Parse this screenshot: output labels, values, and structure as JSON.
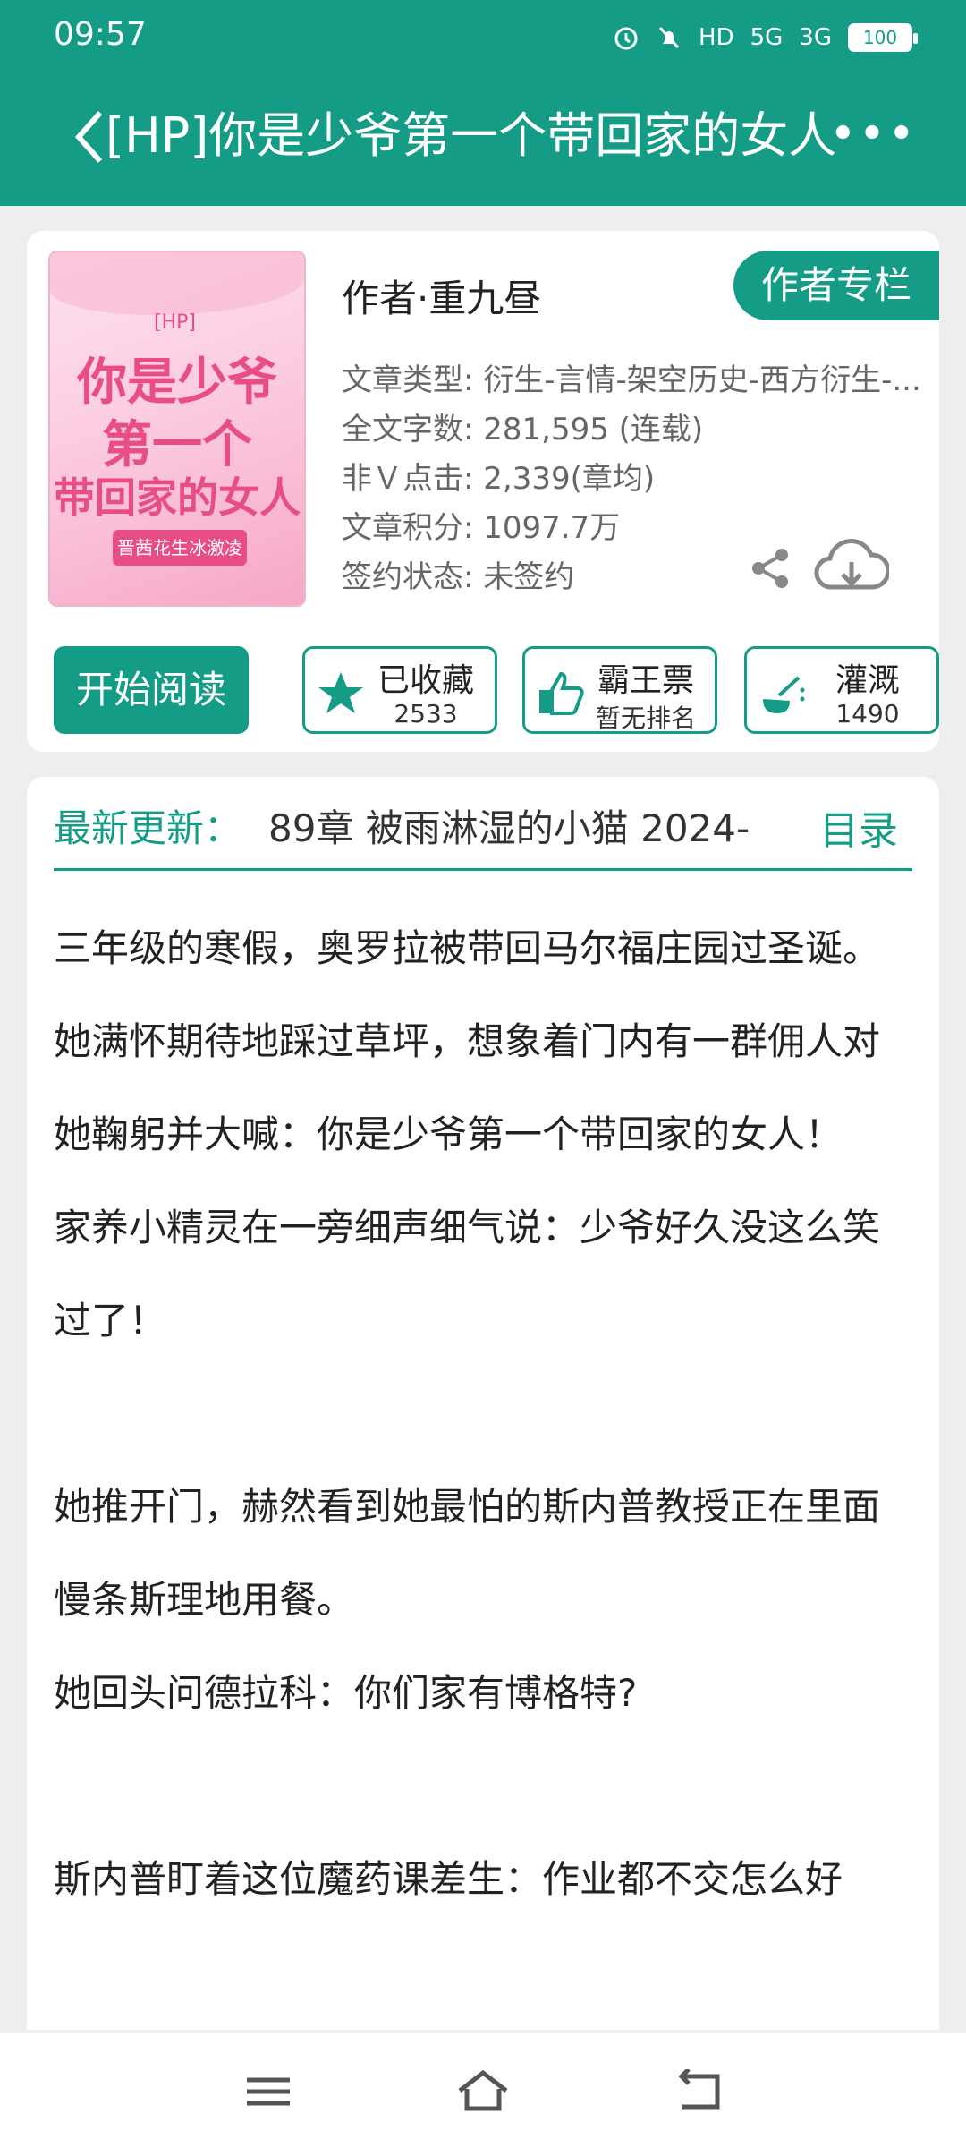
{
  "status_bar": {
    "time": "09:57",
    "signal_5g": "5G",
    "signal_3g": "3G",
    "hd": "HD",
    "battery": "100"
  },
  "header": {
    "title": "[HP]你是少爷第一个带回家的女人",
    "more_label": "•••"
  },
  "book": {
    "cover": {
      "hp_label": "[HP]",
      "line1": "你是少爷",
      "line2": "第一个",
      "line3": "带回家的女人",
      "tag": "晋茜花生冰激凌"
    },
    "author": "作者·重九昼",
    "author_column_button": "作者专栏",
    "meta": [
      "文章类型: 衍生-言情-架空历史-西方衍生-...",
      "全文字数: 281,595 (连载)",
      "非Ｖ点击: 2,339(章均)",
      "文章积分: 1097.7万",
      "签约状态: 未签约"
    ]
  },
  "actions": {
    "start_reading": "开始阅读",
    "collect_label": "已收藏",
    "collect_count": "2533",
    "vote_label": "霸王票",
    "vote_rank": "暂无排名",
    "water_label": "灌溉",
    "water_count": "1490"
  },
  "latest": {
    "label": "最新更新：",
    "text": "89章  被雨淋湿的小猫  2024-",
    "toc": "目录"
  },
  "content": {
    "paragraphs": [
      "三年级的寒假，奥罗拉被带回马尔福庄园过圣诞。",
      "她满怀期待地踩过草坪，想象着门内有一群佣人对她鞠躬并大喊：你是少爷第一个带回家的女人！",
      "家养小精灵在一旁细声细气说：少爷好久没这么笑过了！",
      "",
      "她推开门，赫然看到她最怕的斯内普教授正在里面慢条斯理地用餐。",
      "她回头问德拉科：你们家有博格特?",
      "",
      "斯内普盯着这位魔药课差生：作业都不交怎么好"
    ]
  },
  "colors": {
    "accent": "#159c86",
    "background": "#eeeeee"
  }
}
